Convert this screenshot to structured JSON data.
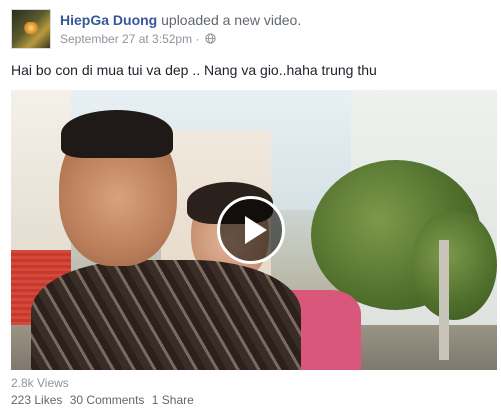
{
  "post": {
    "author": "HiepGa Duong",
    "action": "uploaded a new video.",
    "timestamp": "September 27 at 3:52pm",
    "separator": "·",
    "privacy_icon": "globe-icon",
    "caption": "Hai bo con di mua tui va dep .. Nang va gio..haha trung thu"
  },
  "video": {
    "play_icon": "play-icon",
    "overlay_color": "#000000"
  },
  "stats": {
    "views": "2.8k Views",
    "likes": "223 Likes",
    "comments": "30 Comments",
    "shares": "1 Share"
  },
  "colors": {
    "link": "#365899",
    "meta": "#90949c",
    "text": "#1d2129"
  }
}
